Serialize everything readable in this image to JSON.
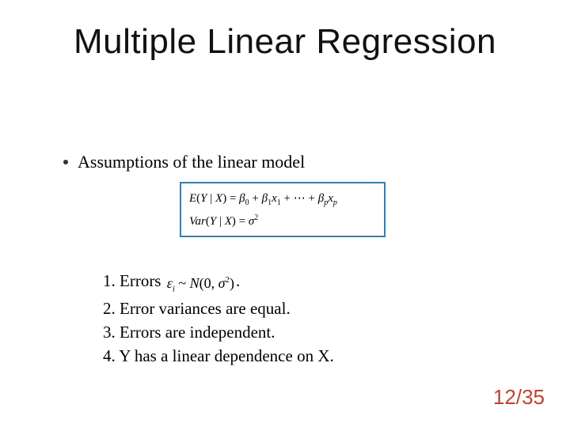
{
  "title": "Multiple Linear Regression",
  "bullet": "Assumptions of the linear model",
  "equations": {
    "line1_html": "<i>E</i>(<i>Y</i> | <i>X</i>) = <i>β</i><span class='sub'>0</span> + <i>β</i><span class='sub'>1</span><i>x</i><span class='sub'>1</span> + ⋯ + <i>β</i><span class='sub'><i>p</i></span><i>x</i><span class='sub'><i>p</i></span>",
    "line2_html": "<i>Var</i>(<i>Y</i> | <i>X</i>) = <i>σ</i><span class='sup'>2</span>"
  },
  "assumptions": {
    "a1_prefix": "1. Errors ",
    "a1_expr_html": "<i>ε</i><span class='subi'>i</span> ~ <i>N</i>(0, <i>σ</i><span class='sup2'>2</span>)",
    "a1_suffix": ".",
    "a2": "2. Error variances are equal.",
    "a3": "3. Errors are independent.",
    "a4": "4. Y has a linear dependence on X."
  },
  "page": "12/35"
}
